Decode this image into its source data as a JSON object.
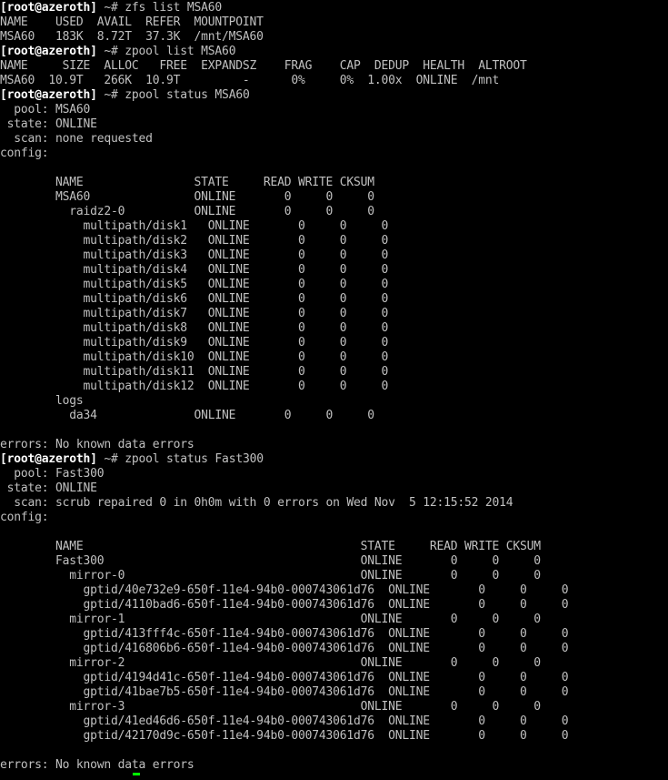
{
  "terminal": {
    "lines": [
      {
        "type": "prompt",
        "user": "[root@azeroth]",
        "rest": " ~# zfs list MSA60"
      },
      {
        "type": "out",
        "text": "NAME    USED  AVAIL  REFER  MOUNTPOINT"
      },
      {
        "type": "out",
        "text": "MSA60   183K  8.72T  37.3K  /mnt/MSA60"
      },
      {
        "type": "prompt",
        "user": "[root@azeroth]",
        "rest": " ~# zpool list MSA60"
      },
      {
        "type": "out",
        "text": "NAME     SIZE  ALLOC   FREE  EXPANDSZ    FRAG    CAP  DEDUP  HEALTH  ALTROOT"
      },
      {
        "type": "out",
        "text": "MSA60  10.9T   266K  10.9T         -      0%     0%  1.00x  ONLINE  /mnt"
      },
      {
        "type": "prompt",
        "user": "[root@azeroth]",
        "rest": " ~# zpool status MSA60"
      },
      {
        "type": "out",
        "text": "  pool: MSA60"
      },
      {
        "type": "out",
        "text": " state: ONLINE"
      },
      {
        "type": "out",
        "text": "  scan: none requested"
      },
      {
        "type": "out",
        "text": "config:"
      },
      {
        "type": "out",
        "text": ""
      },
      {
        "type": "out",
        "text": "        NAME                STATE     READ WRITE CKSUM"
      },
      {
        "type": "out",
        "text": "        MSA60               ONLINE       0     0     0"
      },
      {
        "type": "out",
        "text": "          raidz2-0          ONLINE       0     0     0"
      },
      {
        "type": "out",
        "text": "            multipath/disk1   ONLINE       0     0     0"
      },
      {
        "type": "out",
        "text": "            multipath/disk2   ONLINE       0     0     0"
      },
      {
        "type": "out",
        "text": "            multipath/disk3   ONLINE       0     0     0"
      },
      {
        "type": "out",
        "text": "            multipath/disk4   ONLINE       0     0     0"
      },
      {
        "type": "out",
        "text": "            multipath/disk5   ONLINE       0     0     0"
      },
      {
        "type": "out",
        "text": "            multipath/disk6   ONLINE       0     0     0"
      },
      {
        "type": "out",
        "text": "            multipath/disk7   ONLINE       0     0     0"
      },
      {
        "type": "out",
        "text": "            multipath/disk8   ONLINE       0     0     0"
      },
      {
        "type": "out",
        "text": "            multipath/disk9   ONLINE       0     0     0"
      },
      {
        "type": "out",
        "text": "            multipath/disk10  ONLINE       0     0     0"
      },
      {
        "type": "out",
        "text": "            multipath/disk11  ONLINE       0     0     0"
      },
      {
        "type": "out",
        "text": "            multipath/disk12  ONLINE       0     0     0"
      },
      {
        "type": "out",
        "text": "        logs"
      },
      {
        "type": "out",
        "text": "          da34              ONLINE       0     0     0"
      },
      {
        "type": "out",
        "text": ""
      },
      {
        "type": "out",
        "text": "errors: No known data errors"
      },
      {
        "type": "prompt",
        "user": "[root@azeroth]",
        "rest": " ~# zpool status Fast300"
      },
      {
        "type": "out",
        "text": "  pool: Fast300"
      },
      {
        "type": "out",
        "text": " state: ONLINE"
      },
      {
        "type": "out",
        "text": "  scan: scrub repaired 0 in 0h0m with 0 errors on Wed Nov  5 12:15:52 2014"
      },
      {
        "type": "out",
        "text": "config:"
      },
      {
        "type": "out",
        "text": ""
      },
      {
        "type": "out",
        "text": "        NAME                                        STATE     READ WRITE CKSUM"
      },
      {
        "type": "out",
        "text": "        Fast300                                     ONLINE       0     0     0"
      },
      {
        "type": "out",
        "text": "          mirror-0                                  ONLINE       0     0     0"
      },
      {
        "type": "out",
        "text": "            gptid/40e732e9-650f-11e4-94b0-000743061d76  ONLINE       0     0     0"
      },
      {
        "type": "out",
        "text": "            gptid/4110bad6-650f-11e4-94b0-000743061d76  ONLINE       0     0     0"
      },
      {
        "type": "out",
        "text": "          mirror-1                                  ONLINE       0     0     0"
      },
      {
        "type": "out",
        "text": "            gptid/413fff4c-650f-11e4-94b0-000743061d76  ONLINE       0     0     0"
      },
      {
        "type": "out",
        "text": "            gptid/416806b6-650f-11e4-94b0-000743061d76  ONLINE       0     0     0"
      },
      {
        "type": "out",
        "text": "          mirror-2                                  ONLINE       0     0     0"
      },
      {
        "type": "out",
        "text": "            gptid/4194d41c-650f-11e4-94b0-000743061d76  ONLINE       0     0     0"
      },
      {
        "type": "out",
        "text": "            gptid/41bae7b5-650f-11e4-94b0-000743061d76  ONLINE       0     0     0"
      },
      {
        "type": "out",
        "text": "          mirror-3                                  ONLINE       0     0     0"
      },
      {
        "type": "out",
        "text": "            gptid/41ed46d6-650f-11e4-94b0-000743061d76  ONLINE       0     0     0"
      },
      {
        "type": "out",
        "text": "            gptid/42170d9c-650f-11e4-94b0-000743061d76  ONLINE       0     0     0"
      },
      {
        "type": "out",
        "text": ""
      },
      {
        "type": "out",
        "text": "errors: No known data errors"
      }
    ],
    "colors": {
      "background": "#000000",
      "text": "#c0c0c0",
      "prompt": "#ffffff",
      "cursor": "#00ff00"
    }
  }
}
